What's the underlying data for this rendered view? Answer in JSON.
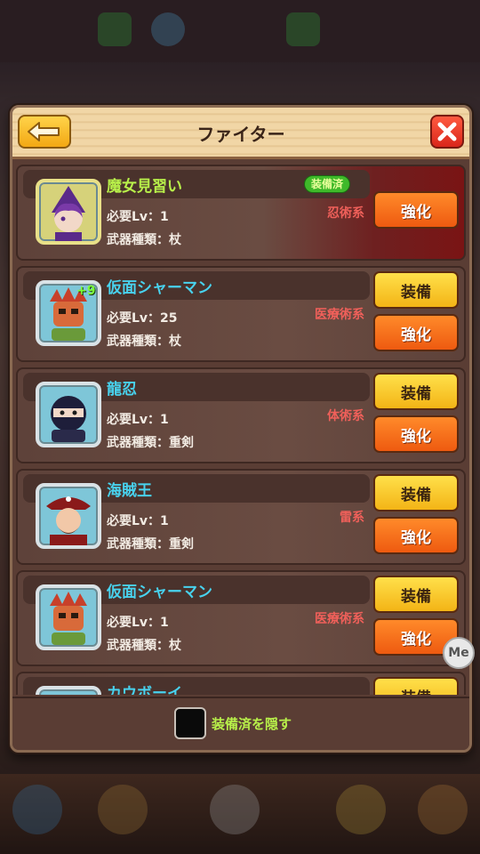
{
  "dialog": {
    "title": "ファイター"
  },
  "icons": {
    "back": "back-arrow-icon",
    "close": "close-x-icon"
  },
  "fighters": [
    {
      "name": "魔女見習い",
      "equipped_badge": "装備済",
      "level_text": "必要Lv：1",
      "weapon_text": "武器種類：杖",
      "school": "忍術系",
      "upgrade_label": "強化",
      "portrait": "witch-apprentice-portrait"
    },
    {
      "name": "仮面シャーマン",
      "plus": "+9",
      "level_text": "必要Lv：25",
      "weapon_text": "武器種類：杖",
      "school": "医療術系",
      "equip_label": "装備",
      "upgrade_label": "強化",
      "portrait": "masked-shaman-portrait"
    },
    {
      "name": "龍忍",
      "level_text": "必要Lv：1",
      "weapon_text": "武器種類：重剣",
      "school": "体術系",
      "equip_label": "装備",
      "upgrade_label": "強化",
      "portrait": "dragon-ninja-portrait"
    },
    {
      "name": "海賊王",
      "level_text": "必要Lv：1",
      "weapon_text": "武器種類：重剣",
      "school": "雷系",
      "equip_label": "装備",
      "upgrade_label": "強化",
      "portrait": "pirate-king-portrait"
    },
    {
      "name": "仮面シャーマン",
      "level_text": "必要Lv：1",
      "weapon_text": "武器種類：杖",
      "school": "医療術系",
      "equip_label": "装備",
      "upgrade_label": "強化",
      "portrait": "masked-shaman-portrait"
    },
    {
      "name": "カウボーイ",
      "equip_label": "装備",
      "portrait": "cowboy-portrait"
    }
  ],
  "footer": {
    "hide_equipped_label": "装備済を隠す",
    "hide_equipped_checked": false
  },
  "overlay": {
    "me_label": "Me"
  },
  "colors": {
    "name_cyan": "#48d2ee",
    "name_equipped": "#b8f04a",
    "school_red": "#f0605a",
    "equip_yellow": "#f3b416",
    "upgrade_orange": "#ee5a10"
  }
}
